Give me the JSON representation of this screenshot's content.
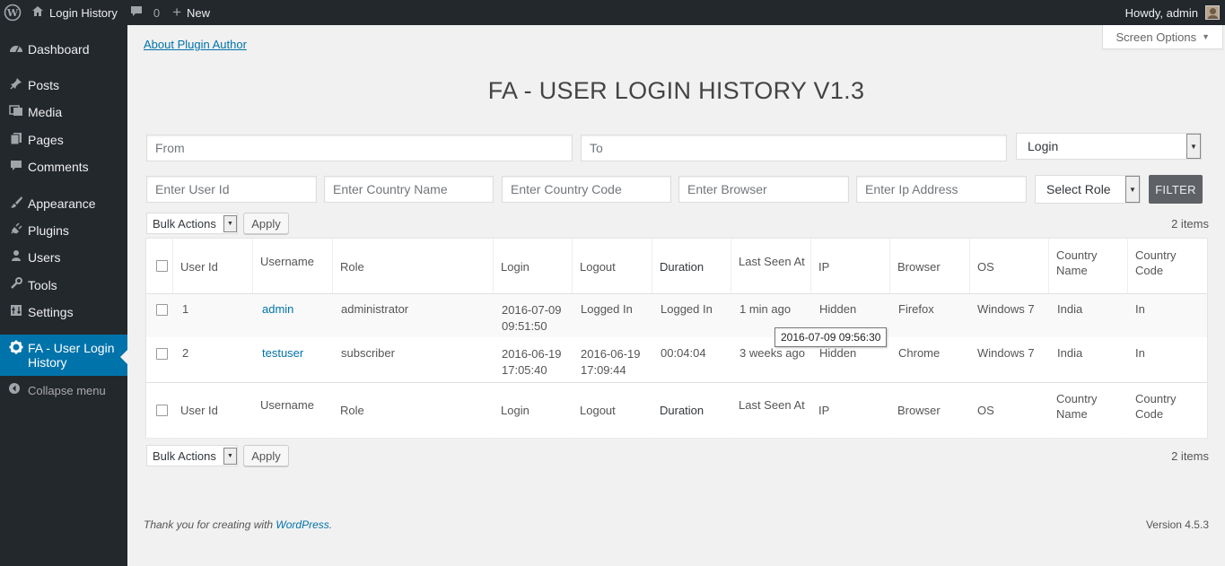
{
  "adminbar": {
    "site_name": "Login History",
    "comments_count": "0",
    "new_label": "New",
    "howdy": "Howdy, admin"
  },
  "sidebar": {
    "items": [
      {
        "label": "Dashboard",
        "icon": "dashboard-icon"
      },
      {
        "label": "Posts",
        "icon": "pin-icon"
      },
      {
        "label": "Media",
        "icon": "media-icon"
      },
      {
        "label": "Pages",
        "icon": "pages-icon"
      },
      {
        "label": "Comments",
        "icon": "comments-icon"
      },
      {
        "label": "Appearance",
        "icon": "brush-icon"
      },
      {
        "label": "Plugins",
        "icon": "plugin-icon"
      },
      {
        "label": "Users",
        "icon": "users-icon"
      },
      {
        "label": "Tools",
        "icon": "wrench-icon"
      },
      {
        "label": "Settings",
        "icon": "settings-icon"
      },
      {
        "label": "FA - User Login History",
        "icon": "gear-icon"
      }
    ],
    "collapse_label": "Collapse menu"
  },
  "main": {
    "about_link": "About Plugin Author",
    "screen_options": "Screen Options",
    "title": "FA - USER LOGIN HISTORY V1.3",
    "filters": {
      "from_placeholder": "From",
      "to_placeholder": "To",
      "type_selected": "Login",
      "user_id_placeholder": "Enter User Id",
      "country_name_placeholder": "Enter Country Name",
      "country_code_placeholder": "Enter Country Code",
      "browser_placeholder": "Enter Browser",
      "ip_placeholder": "Enter Ip Address",
      "role_selected": "Select Role",
      "filter_button": "FILTER"
    },
    "bulk_actions": "Bulk Actions",
    "apply": "Apply",
    "items_count": "2 items",
    "columns": {
      "user_id": "User Id",
      "username": "Username",
      "role": "Role",
      "login": "Login",
      "logout": "Logout",
      "duration": "Duration",
      "last_seen": "Last Seen At",
      "ip": "IP",
      "browser": "Browser",
      "os": "OS",
      "country_name_1": "Country",
      "country_name_2": "Name",
      "country_code_1": "Country",
      "country_code_2": "Code"
    },
    "rows": [
      {
        "user_id": "1",
        "username": "admin",
        "role": "administrator",
        "login_date": "2016-07-09",
        "login_time": "09:51:50",
        "logout": "Logged In",
        "logout_time": "",
        "duration": "Logged In",
        "last_seen": "1 min ago",
        "ip": "Hidden",
        "browser": "Firefox",
        "os": "Windows 7",
        "country_name": "India",
        "country_code": "In"
      },
      {
        "user_id": "2",
        "username": "testuser",
        "role": "subscriber",
        "login_date": "2016-06-19",
        "login_time": "17:05:40",
        "logout": "2016-06-19",
        "logout_time": "17:09:44",
        "duration": "00:04:04",
        "last_seen": "3 weeks ago",
        "ip": "Hidden",
        "browser": "Chrome",
        "os": "Windows 7",
        "country_name": "India",
        "country_code": "In"
      }
    ],
    "tooltip": "2016-07-09 09:56:30"
  },
  "footer": {
    "thanks_prefix": "Thank you for creating with ",
    "wordpress_link": "WordPress",
    "thanks_suffix": ".",
    "version": "Version 4.5.3"
  }
}
